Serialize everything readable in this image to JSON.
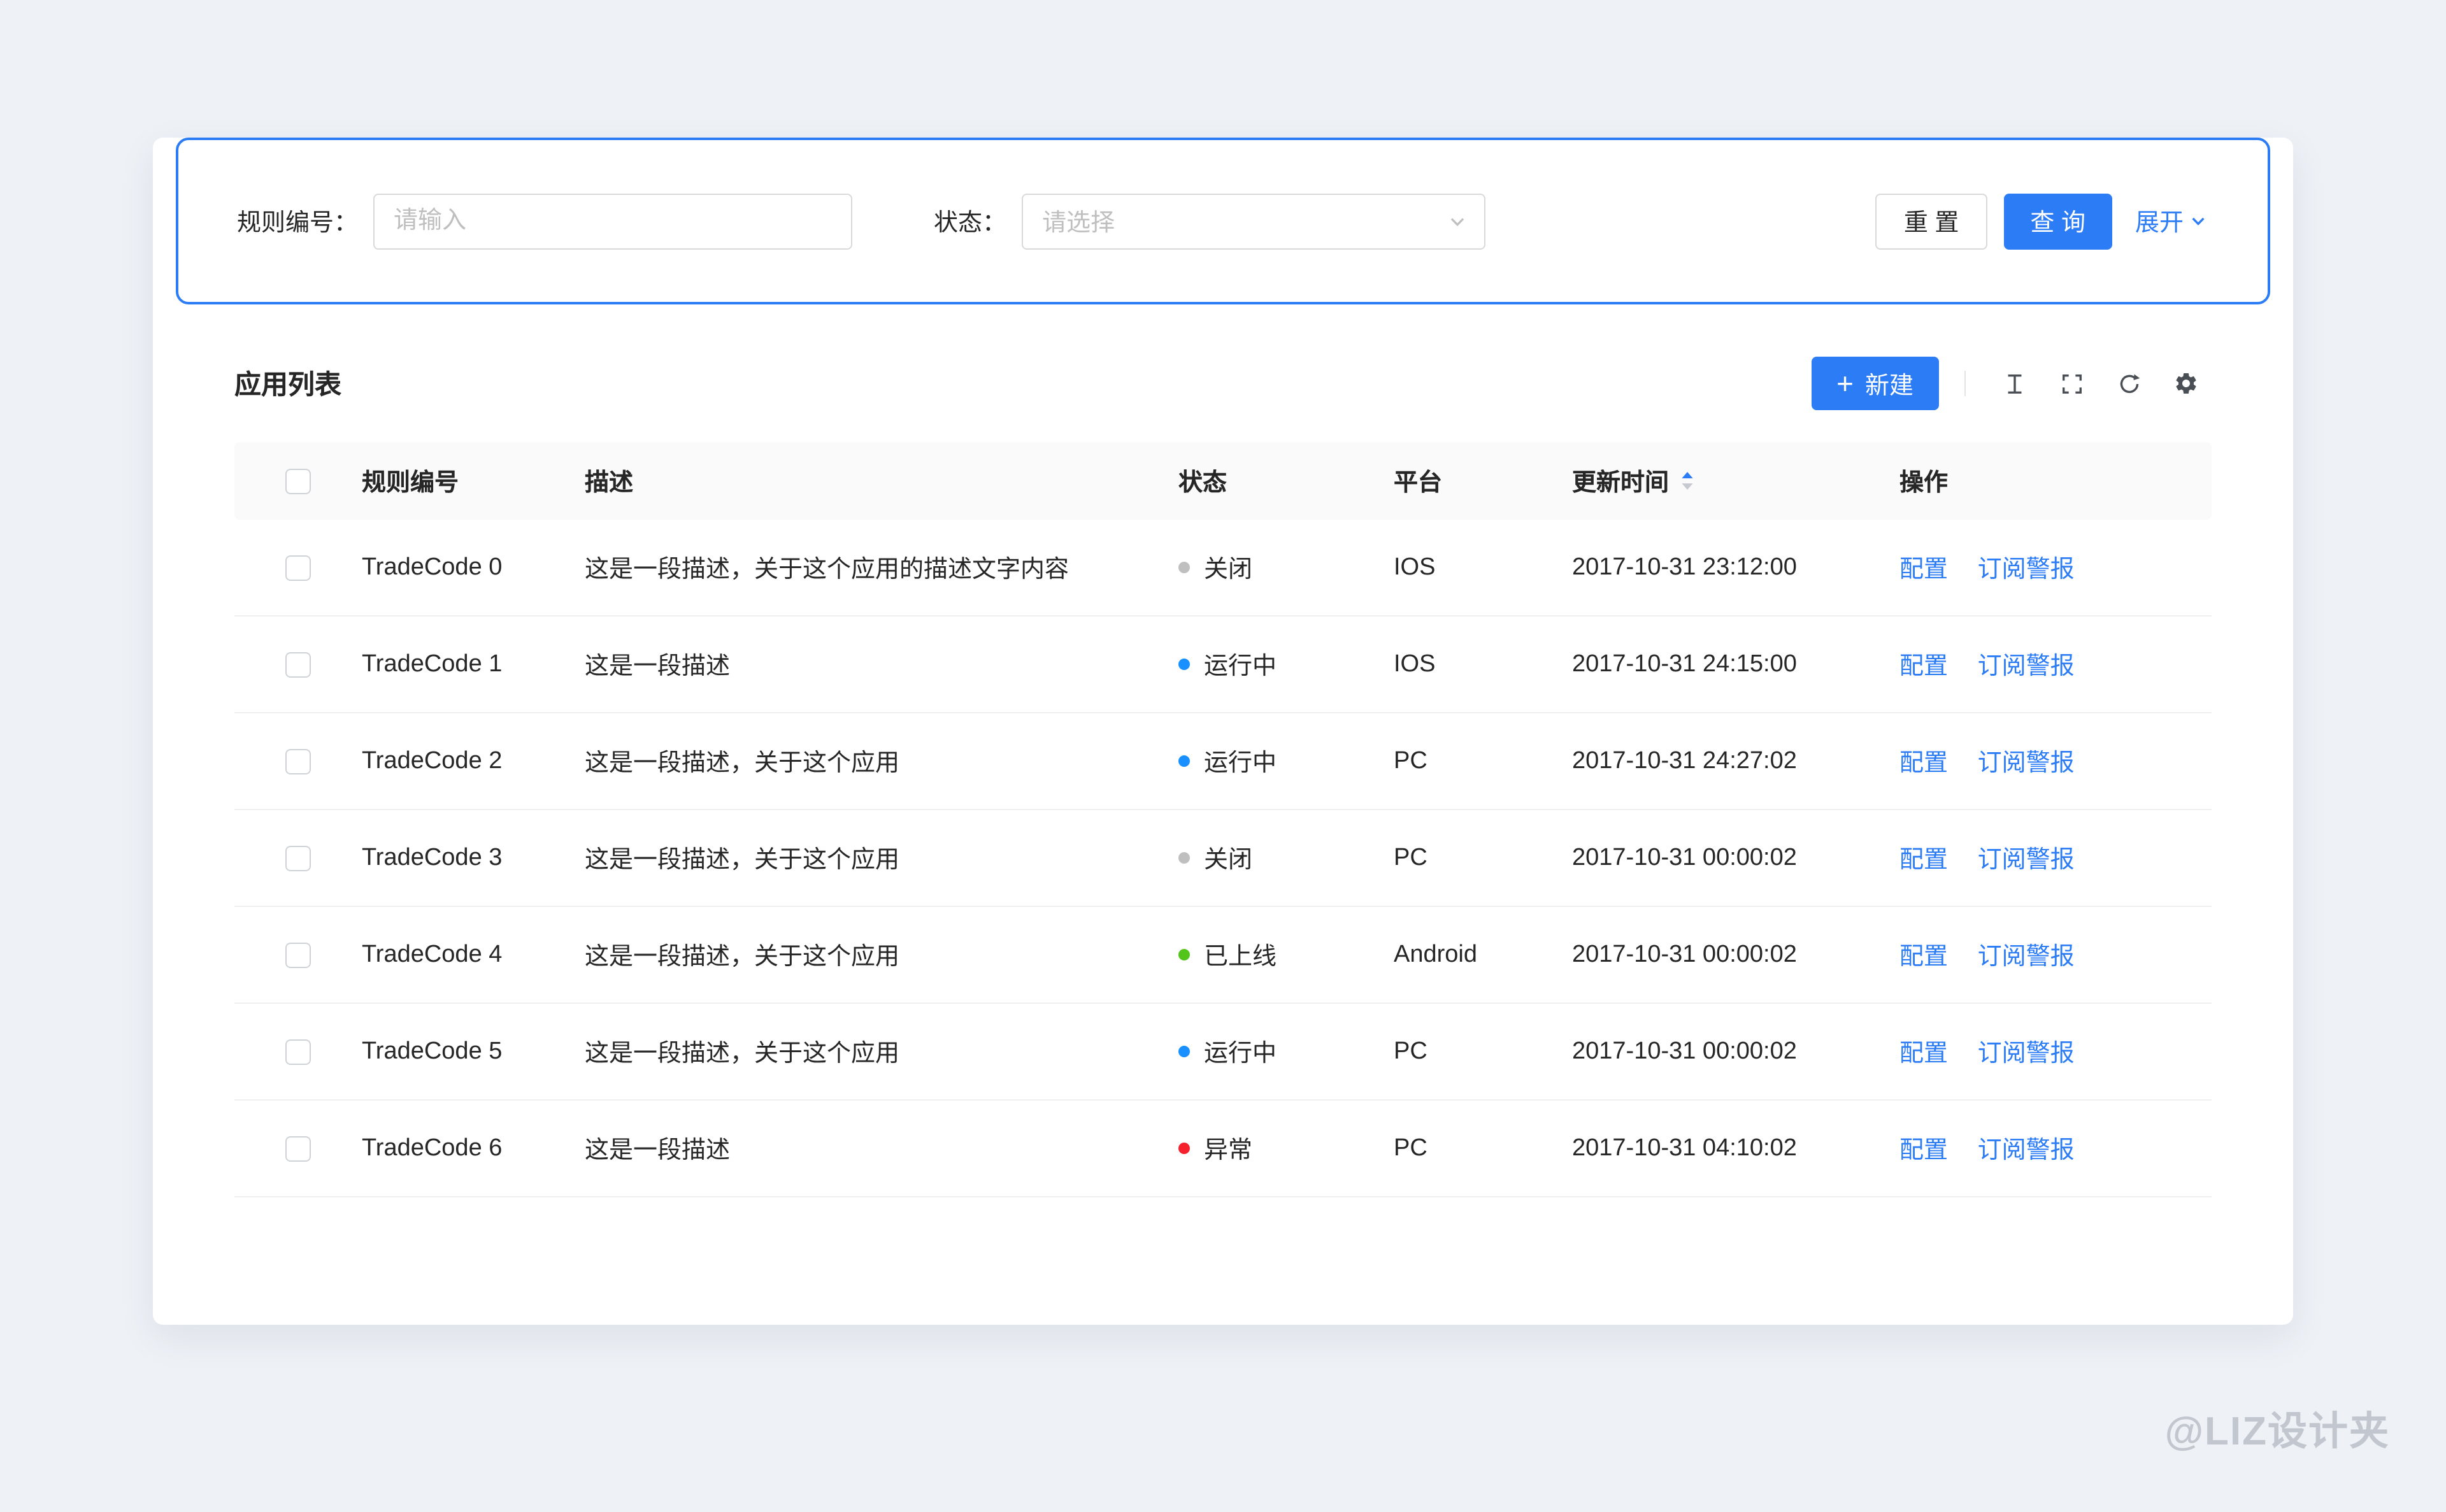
{
  "filter": {
    "rule_label": "规则编号：",
    "rule_placeholder": "请输入",
    "status_label": "状态：",
    "status_placeholder": "请选择",
    "reset_label": "重 置",
    "query_label": "查 询",
    "expand_label": "展开"
  },
  "list": {
    "title": "应用列表",
    "new_button": "新建",
    "plus_icon": "+",
    "toolbar_icon_names": [
      "density-icon",
      "fullscreen-icon",
      "reload-icon",
      "settings-icon"
    ]
  },
  "table": {
    "headers": {
      "code": "规则编号",
      "desc": "描述",
      "status": "状态",
      "platform": "平台",
      "time": "更新时间",
      "action": "操作"
    },
    "action_config": "配置",
    "action_subscribe": "订阅警报",
    "rows": [
      {
        "code": "TradeCode 0",
        "desc": "这是一段描述，关于这个应用的描述文字内容",
        "status": "关闭",
        "dot": "#bfbfbf",
        "platform": "IOS",
        "time": "2017-10-31 23:12:00"
      },
      {
        "code": "TradeCode 1",
        "desc": "这是一段描述",
        "status": "运行中",
        "dot": "#1890ff",
        "platform": "IOS",
        "time": "2017-10-31 24:15:00"
      },
      {
        "code": "TradeCode 2",
        "desc": "这是一段描述，关于这个应用",
        "status": "运行中",
        "dot": "#1890ff",
        "platform": "PC",
        "time": "2017-10-31 24:27:02"
      },
      {
        "code": "TradeCode 3",
        "desc": "这是一段描述，关于这个应用",
        "status": "关闭",
        "dot": "#bfbfbf",
        "platform": "PC",
        "time": "2017-10-31 00:00:02"
      },
      {
        "code": "TradeCode 4",
        "desc": "这是一段描述，关于这个应用",
        "status": "已上线",
        "dot": "#52c41a",
        "platform": "Android",
        "time": "2017-10-31 00:00:02"
      },
      {
        "code": "TradeCode 5",
        "desc": "这是一段描述，关于这个应用",
        "status": "运行中",
        "dot": "#1890ff",
        "platform": "PC",
        "time": "2017-10-31 00:00:02"
      },
      {
        "code": "TradeCode 6",
        "desc": "这是一段描述",
        "status": "异常",
        "dot": "#f5222d",
        "platform": "PC",
        "time": "2017-10-31 04:10:02"
      }
    ]
  },
  "watermark": "@LIZ设计夹",
  "colors": {
    "primary": "#2b7cf5",
    "status_running": "#1890ff",
    "status_online": "#52c41a",
    "status_error": "#f5222d",
    "status_closed": "#bfbfbf",
    "page_background": "#eef1f6"
  }
}
